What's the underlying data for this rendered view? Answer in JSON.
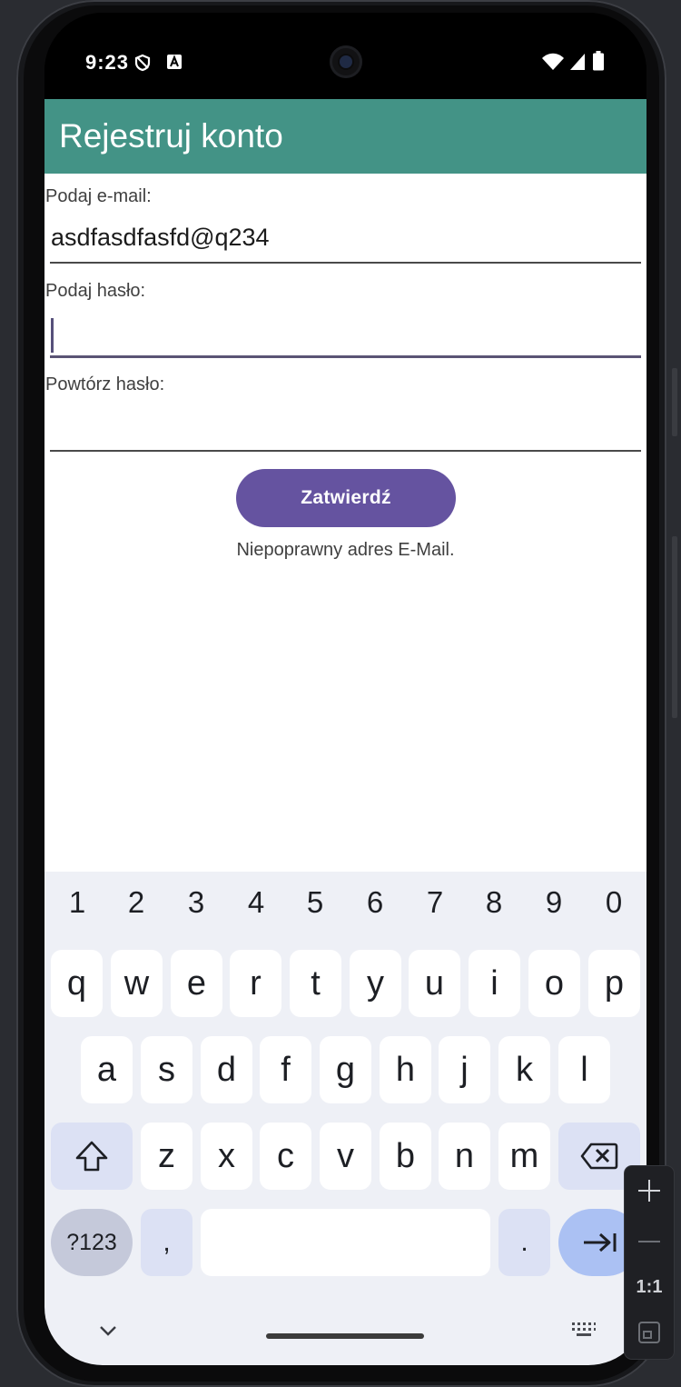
{
  "status_bar": {
    "time": "9:23"
  },
  "app_bar": {
    "title": "Rejestruj konto"
  },
  "form": {
    "email_label": "Podaj e-mail:",
    "email_value": "asdfasdfasfd@q234",
    "password_label": "Podaj hasło:",
    "password_value": "",
    "repeat_label": "Powtórz hasło:",
    "repeat_value": "",
    "submit_label": "Zatwierdź",
    "error_message": "Niepoprawny adres E-Mail."
  },
  "keyboard": {
    "number_row": [
      "1",
      "2",
      "3",
      "4",
      "5",
      "6",
      "7",
      "8",
      "9",
      "0"
    ],
    "row1": [
      "q",
      "w",
      "e",
      "r",
      "t",
      "y",
      "u",
      "i",
      "o",
      "p"
    ],
    "row2": [
      "a",
      "s",
      "d",
      "f",
      "g",
      "h",
      "j",
      "k",
      "l"
    ],
    "row3": [
      "z",
      "x",
      "c",
      "v",
      "b",
      "n",
      "m"
    ],
    "symbols_label": "?123",
    "comma_label": ",",
    "period_label": "."
  },
  "zoom_control": {
    "reset_label": "1:1"
  },
  "colors": {
    "app_bar": "#439386",
    "button": "#6553a0",
    "keyboard_bg": "#eef0f6",
    "enter_key": "#abc1f3"
  }
}
